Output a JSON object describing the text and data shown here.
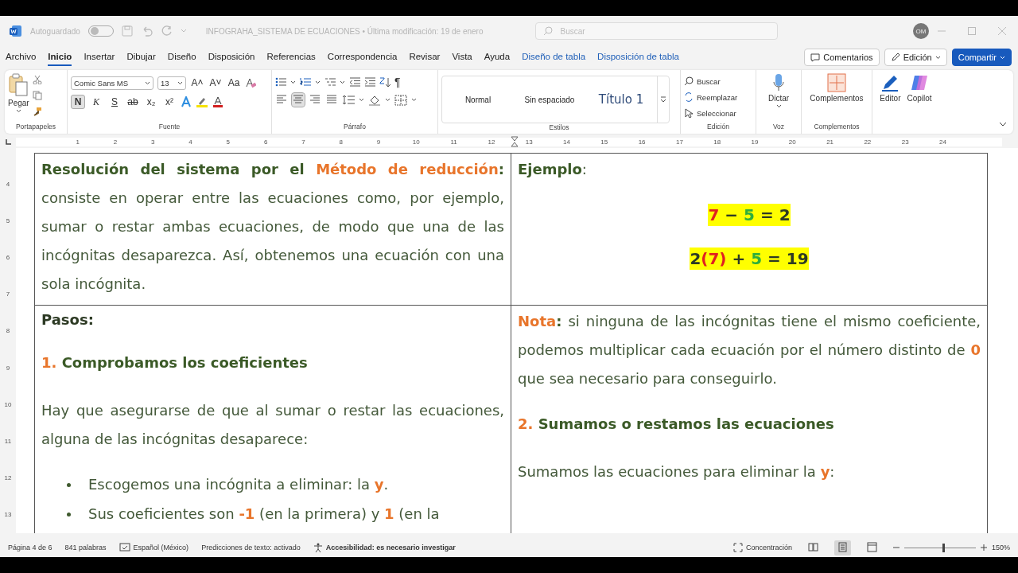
{
  "title_bar": {
    "autosave_label": "Autoguardado",
    "autosave_on": false,
    "document_title": "INFOGRAHA_SISTEMA DE ECUACIONES • Última modificación: 19 de enero",
    "search_placeholder": "Buscar",
    "user_initials": "OM"
  },
  "menu_tabs": [
    {
      "label": "Archivo",
      "kind": "standard",
      "selected": false
    },
    {
      "label": "Inicio",
      "kind": "standard",
      "selected": true
    },
    {
      "label": "Insertar",
      "kind": "standard",
      "selected": false
    },
    {
      "label": "Dibujar",
      "kind": "standard",
      "selected": false
    },
    {
      "label": "Diseño",
      "kind": "standard",
      "selected": false
    },
    {
      "label": "Disposición",
      "kind": "standard",
      "selected": false
    },
    {
      "label": "Referencias",
      "kind": "standard",
      "selected": false
    },
    {
      "label": "Correspondencia",
      "kind": "standard",
      "selected": false
    },
    {
      "label": "Revisar",
      "kind": "standard",
      "selected": false
    },
    {
      "label": "Vista",
      "kind": "standard",
      "selected": false
    },
    {
      "label": "Ayuda",
      "kind": "standard",
      "selected": false
    },
    {
      "label": "Diseño de tabla",
      "kind": "contextual",
      "selected": false
    },
    {
      "label": "Disposición de tabla",
      "kind": "contextual",
      "selected": false
    }
  ],
  "header_buttons": [
    {
      "label": "Comentarios",
      "kind": "comments"
    },
    {
      "label": "Edición",
      "kind": "editing"
    },
    {
      "label": "Compartir",
      "kind": "share"
    }
  ],
  "ribbon": {
    "clipboard": {
      "paste_label": "Pegar",
      "group_label": "Portapapeles"
    },
    "font": {
      "name": "Comic Sans MS",
      "size": "13",
      "size_buttons": [
        "A˄",
        "A˅",
        "Aa"
      ],
      "group_label": "Fuente",
      "format_buttons": [
        {
          "label": "N",
          "kind": "bold",
          "selected": true
        },
        {
          "label": "K",
          "kind": "italic",
          "selected": false
        },
        {
          "label": "S",
          "kind": "underline",
          "selected": false
        },
        {
          "label": "ab",
          "kind": "strike",
          "selected": false
        },
        {
          "label": "x₂",
          "kind": "sub",
          "selected": false
        },
        {
          "label": "x²",
          "kind": "sup",
          "selected": false
        }
      ]
    },
    "paragraph": {
      "pilcrow": "¶",
      "group_label": "Párrafo",
      "alignments": [
        {
          "kind": "left",
          "selected": false
        },
        {
          "kind": "center",
          "selected": true
        },
        {
          "kind": "right",
          "selected": false
        },
        {
          "kind": "justify",
          "selected": false
        }
      ]
    },
    "styles": {
      "group_label": "Estilos",
      "items": [
        {
          "label": "Normal",
          "kind": "normal"
        },
        {
          "label": "Sin espaciado",
          "kind": "normal"
        },
        {
          "label": "Título 1",
          "kind": "heading"
        }
      ]
    },
    "editing": {
      "group_label": "Edición",
      "items": [
        {
          "label": "Buscar",
          "kind": "find"
        },
        {
          "label": "Reemplazar",
          "kind": "replace"
        },
        {
          "label": "Seleccionar",
          "kind": "select"
        }
      ]
    },
    "voice": {
      "label": "Dictar",
      "group_label": "Voz"
    },
    "addins": {
      "label": "Complementos",
      "group_label": "Complementos"
    },
    "extra": [
      {
        "label": "Editor",
        "kind": "editor"
      },
      {
        "label": "Copilot",
        "kind": "copilot"
      }
    ]
  },
  "ruler": {
    "horizontal": [
      "1",
      "2",
      "3",
      "4",
      "5",
      "6",
      "7",
      "8",
      "9",
      "10",
      "11",
      "12",
      "13",
      "14",
      "15",
      "16",
      "17",
      "18",
      "19",
      "20",
      "21",
      "22",
      "23",
      "24"
    ],
    "vertical": [
      "4",
      "5",
      "6",
      "7",
      "8",
      "9",
      "10",
      "11",
      "12",
      "13"
    ]
  },
  "document": {
    "rows": [
      {
        "cells": [
          {
            "blocks": [
              {
                "kind": "paragraph",
                "runs": [
                  {
                    "kind": "strong",
                    "text": "Resolución del sistema por el "
                  },
                  {
                    "kind": "accent",
                    "text": "Método de reducción"
                  },
                  {
                    "kind": "strong",
                    "text": ":"
                  },
                  {
                    "kind": "plain",
                    "text": " consiste en operar entre las ecuaciones como, por ejemplo, sumar o restar ambas ecuaciones, de modo que una de las incógnitas desaparezca. Así, obtenemos una ecuación con una sola incógnita."
                  }
                ]
              }
            ]
          },
          {
            "blocks": [
              {
                "kind": "paragraph",
                "runs": [
                  {
                    "kind": "strong",
                    "text": "Ejemplo"
                  },
                  {
                    "kind": "plain",
                    "text": ":"
                  }
                ]
              },
              {
                "kind": "equation",
                "runs": [
                  {
                    "kind": "x_value",
                    "text": "7"
                  },
                  {
                    "kind": "dark",
                    "text": " − "
                  },
                  {
                    "kind": "y_value",
                    "text": "5"
                  },
                  {
                    "kind": "dark",
                    "text": " = 2"
                  }
                ]
              },
              {
                "kind": "equation",
                "runs": [
                  {
                    "kind": "dark",
                    "text": "2"
                  },
                  {
                    "kind": "x_value",
                    "text": "(7)"
                  },
                  {
                    "kind": "dark",
                    "text": " + "
                  },
                  {
                    "kind": "y_value",
                    "text": "5"
                  },
                  {
                    "kind": "dark",
                    "text": " = 19"
                  }
                ]
              }
            ]
          }
        ]
      },
      {
        "cells": [
          {
            "blocks": [
              {
                "kind": "label",
                "runs": [
                  {
                    "kind": "dark",
                    "text": "Pasos:"
                  }
                ]
              },
              {
                "kind": "heading",
                "runs": [
                  {
                    "kind": "accent",
                    "text": "1."
                  },
                  {
                    "kind": "strong",
                    "text": " Comprobamos los coeficientes"
                  }
                ]
              },
              {
                "kind": "paragraph",
                "runs": [
                  {
                    "kind": "plain",
                    "text": "Hay que asegurarse de que al sumar o restar las ecuaciones, alguna de las incógnitas desaparece:"
                  }
                ]
              },
              {
                "kind": "bullet",
                "runs": [
                  {
                    "kind": "plain",
                    "text": "Escogemos una incógnita a eliminar: la "
                  },
                  {
                    "kind": "accent",
                    "text": "y"
                  },
                  {
                    "kind": "plain",
                    "text": "."
                  }
                ]
              },
              {
                "kind": "bullet",
                "runs": [
                  {
                    "kind": "plain",
                    "text": "Sus coeficientes son "
                  },
                  {
                    "kind": "accent",
                    "text": "-1"
                  },
                  {
                    "kind": "plain",
                    "text": " (en la primera) y "
                  },
                  {
                    "kind": "accent",
                    "text": "1"
                  },
                  {
                    "kind": "plain",
                    "text": " (en la"
                  }
                ]
              }
            ]
          },
          {
            "blocks": [
              {
                "kind": "paragraph",
                "runs": [
                  {
                    "kind": "accent",
                    "text": "Nota"
                  },
                  {
                    "kind": "strong",
                    "text": ":"
                  },
                  {
                    "kind": "plain",
                    "text": " si ninguna de las incógnitas tiene el mismo coeficiente, podemos multiplicar cada ecuación por el número distinto de "
                  },
                  {
                    "kind": "accent",
                    "text": "0"
                  },
                  {
                    "kind": "plain",
                    "text": " que sea necesario para conseguirlo."
                  }
                ]
              },
              {
                "kind": "heading",
                "runs": [
                  {
                    "kind": "accent",
                    "text": "2."
                  },
                  {
                    "kind": "strong",
                    "text": " Sumamos o restamos las ecuaciones"
                  }
                ]
              },
              {
                "kind": "paragraph",
                "runs": [
                  {
                    "kind": "plain",
                    "text": "Sumamos las ecuaciones para eliminar la "
                  },
                  {
                    "kind": "accent",
                    "text": "y"
                  },
                  {
                    "kind": "plain",
                    "text": ":"
                  }
                ]
              }
            ]
          }
        ]
      }
    ]
  },
  "status_bar": {
    "page": "Página 4 de 6",
    "words": "841 palabras",
    "language": "Español (México)",
    "predictions": "Predicciones de texto: activado",
    "accessibility": "Accesibilidad: es necesario investigar",
    "focus": "Concentración",
    "views": [
      {
        "kind": "read",
        "selected": false
      },
      {
        "kind": "print",
        "selected": true
      },
      {
        "kind": "web",
        "selected": false
      }
    ],
    "zoom": {
      "level": 0.55
    },
    "zoom_label": "150%"
  }
}
